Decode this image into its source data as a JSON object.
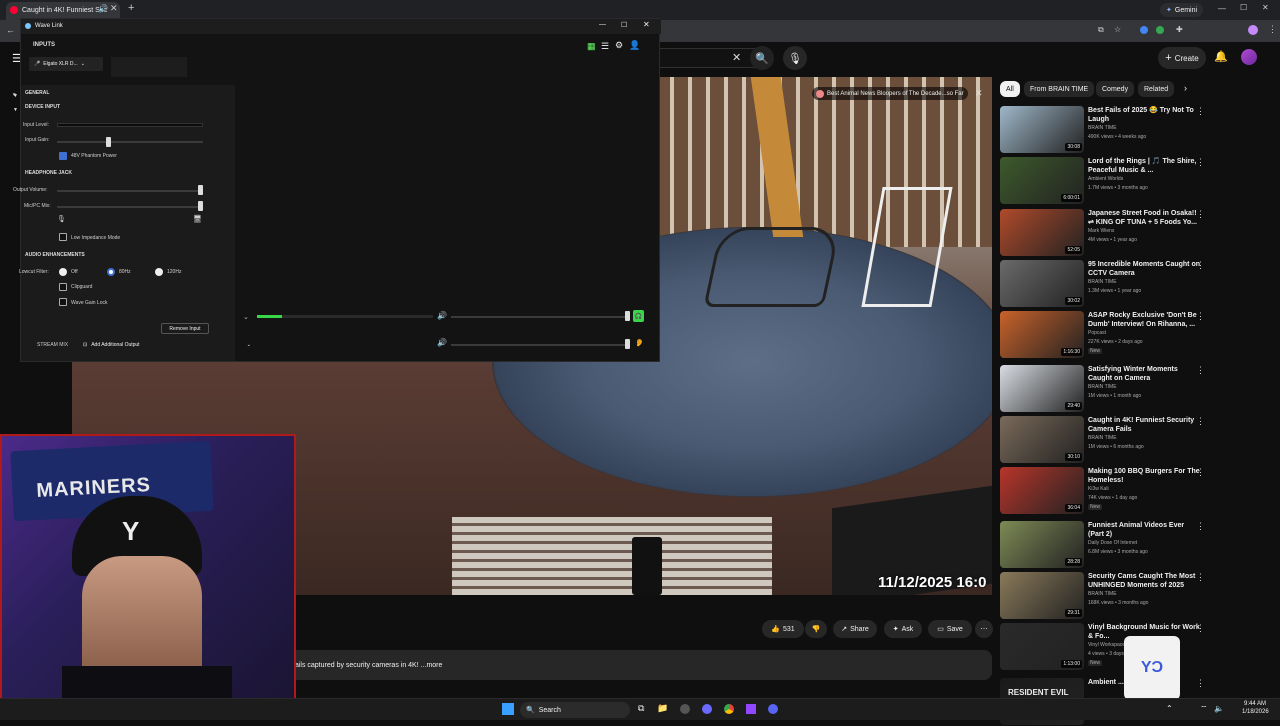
{
  "browser": {
    "tab_title": "Caught in 4K! Funniest Sec",
    "gemini_label": "Gemini"
  },
  "youtube": {
    "create_label": "Create",
    "video": {
      "overlay_title": "Best Animal News Bloopers of The Decade...so Far",
      "timestamp": "11/12/2025 16:0",
      "likes": "531",
      "share_label": "Share",
      "ask_label": "Ask",
      "save_label": "Save",
      "description": "fails captured by security cameras in 4K! ...more"
    },
    "chips": [
      "All",
      "From BRAIN TIME",
      "Comedy",
      "Related"
    ],
    "recommendations": [
      {
        "title": "Best Fails of 2025 😂 Try Not To Laugh",
        "channel": "BRAIN TIME",
        "meta": "490K views • 4 weeks ago",
        "duration": "30:08",
        "badge": "",
        "color": "#9fb7c9"
      },
      {
        "title": "Lord of the Rings | 🎵 The Shire, Peaceful Music & ...",
        "channel": "Ambient Worlds",
        "meta": "1.7M views • 3 months ago",
        "duration": "6:00:01",
        "badge": "",
        "color": "#3d5a2c"
      },
      {
        "title": "Japanese Street Food in Osaka!! ⇌ KING OF TUNA + 5 Foods Yo...",
        "channel": "Mark Wiens",
        "meta": "4M views • 1 year ago",
        "duration": "52:05",
        "badge": "",
        "color": "#b04a2a"
      },
      {
        "title": "95 Incredible Moments Caught on CCTV Camera",
        "channel": "BRAIN TIME",
        "meta": "1.3M views • 1 year ago",
        "duration": "30:02",
        "badge": "",
        "color": "#6a6a6a"
      },
      {
        "title": "ASAP Rocky Exclusive 'Don't Be Dumb' Interview! On Rihanna, ...",
        "channel": "Popcast",
        "meta": "227K views • 2 days ago",
        "duration": "1:16:30",
        "badge": "New",
        "color": "#c9622a"
      },
      {
        "title": "Satisfying Winter Moments Caught on Camera",
        "channel": "BRAIN TIME",
        "meta": "1M views • 1 month ago",
        "duration": "29:40",
        "badge": "",
        "color": "#d9dde3"
      },
      {
        "title": "Caught in 4K! Funniest Security Camera Fails",
        "channel": "BRAIN TIME",
        "meta": "1M views • 6 months ago",
        "duration": "30:10",
        "badge": "",
        "color": "#7a6a5a"
      },
      {
        "title": "Making 100 BBQ Burgers For The Homeless!",
        "channel": "Ki3w Kali",
        "meta": "74K views • 1 day ago",
        "duration": "36:04",
        "badge": "New",
        "color": "#b8352a"
      },
      {
        "title": "Funniest Animal Videos Ever (Part 2)",
        "channel": "Daily Dose Of Internet",
        "meta": "6.8M views • 3 months ago",
        "duration": "28:28",
        "badge": "",
        "color": "#7e8a55"
      },
      {
        "title": "Security Cams Caught The Most UNHINGED Moments of 2025",
        "channel": "BRAIN TIME",
        "meta": "168K views • 3 months ago",
        "duration": "29:31",
        "badge": "",
        "color": "#8a7a5a"
      },
      {
        "title": "Vinyl Background Music for Work & Fo...",
        "channel": "Vinyl Workspace",
        "meta": "4 views • 3 days ago",
        "duration": "1:13:00",
        "badge": "New",
        "color": "#2a2a2a"
      },
      {
        "title": "Ambient ... Evil Music ...",
        "channel": "",
        "meta": "",
        "duration": "",
        "badge": "",
        "color": "#1a1a1a",
        "thumb_text": "RESIDENT EVIL"
      }
    ]
  },
  "wavelink": {
    "title": "Wave Link",
    "inputs_label": "INPUTS",
    "device_name": "Elgato XLR D...",
    "sections": {
      "general": "GENERAL",
      "device_input": "DEVICE INPUT",
      "headphone_jack": "HEADPHONE JACK",
      "audio_enh": "AUDIO ENHANCEMENTS"
    },
    "input_level": "Input Level:",
    "input_gain": "Input Gain:",
    "phantom": "48V Phantom Power",
    "output_volume": "Output Volume:",
    "mic_pc_mix": "Mic/PC Mix:",
    "low_impedance": "Low Impedance Mode",
    "lowcut": "Lowcut Filter:",
    "lowcut_opts": [
      "Off",
      "80Hz",
      "120Hz"
    ],
    "clipguard": "Clipguard",
    "wave_gain_lock": "Wave Gain Lock",
    "remove_input": "Remove Input",
    "stream_mix": "STREAM MIX",
    "add_output": "Add Additional Output",
    "input_gain_level": 0.35,
    "output_volume_level": 0.98,
    "mix_level": 0.98
  },
  "webcam": {
    "banner_text": "MARINERS"
  },
  "taskbar": {
    "search_label": "Search",
    "time": "9:44 AM",
    "date": "1/18/2026"
  }
}
